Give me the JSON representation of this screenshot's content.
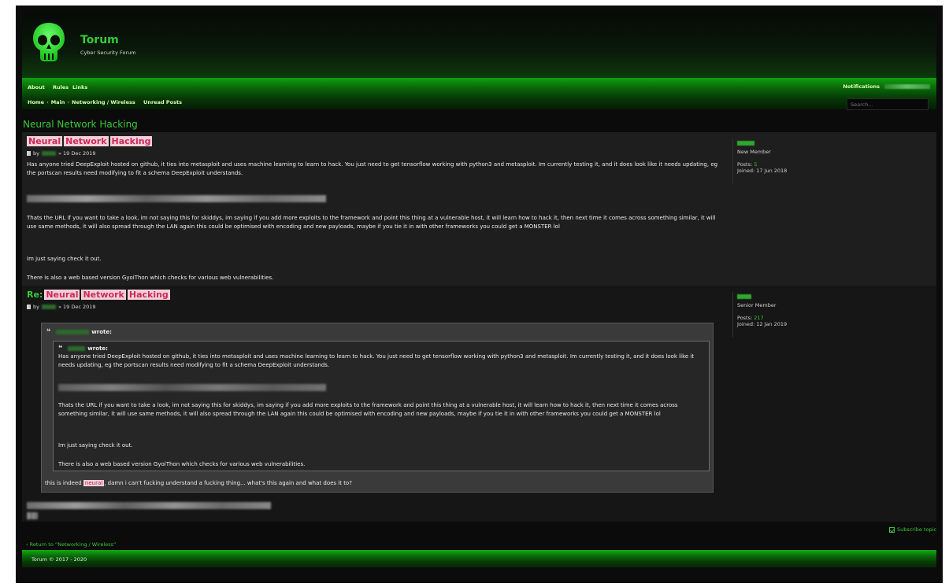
{
  "site": {
    "title": "Torum",
    "description": "Cyber Security Forum"
  },
  "nav": {
    "links": [
      "About",
      "Rules",
      "Links"
    ],
    "notifications_label": "Notifications",
    "breadcrumb": [
      "Home",
      "Main",
      "Networking / Wireless"
    ],
    "breadcrumb_sep": "‹",
    "unread_posts": "Unread Posts",
    "search_placeholder": "Search..."
  },
  "page_title": "Neural Network Hacking",
  "posts": [
    {
      "title_words": [
        "Neural",
        "Network",
        "Hacking"
      ],
      "meta_by": "by",
      "meta_date": "» 19 Dec 2019",
      "paragraphs": [
        "Has anyone tried DeepExploit hosted on github, it ties into metasploit and uses machine learning to learn to hack. You just need to get tensorflow working with python3 and metasploit. Im currently testing it, and it does look like it needs updating, eg the portscan results need modifying to fit a schema DeepExploit understands.",
        "Thats the URL if you want to take a look, im not saying this for skiddys, im saying if you add more exploits to the framework and point this thing at a vulnerable host, it will learn how to hack it, then next time it comes across something similar, it will use same methods, it will also spread through the LAN again this could be optimised with encoding and new payloads, maybe if you tie it in with other frameworks you could get a MONSTER lol",
        "Im just saying check it out.",
        "There is also a web based version GyoiThon which checks for various web vulnerabilities."
      ],
      "profile": {
        "rank": "New Member",
        "posts_label": "Posts:",
        "posts_value": "5",
        "joined": "Joined: 17 Jun 2018"
      }
    },
    {
      "title_prefix": "Re:",
      "title_words": [
        "Neural",
        "Network",
        "Hacking"
      ],
      "meta_by": "by",
      "meta_date": "» 19 Dec 2019",
      "outer_quote_wrote": "wrote:",
      "inner_quote_wrote": "wrote:",
      "quote_paragraphs": [
        "Has anyone tried DeepExploit hosted on github, it ties into metasploit and uses machine learning to learn to hack. You just need to get tensorflow working with python3 and metasploit. Im currently testing it, and it does look like it needs updating, eg the portscan results need modifying to fit a schema DeepExploit understands.",
        "Thats the URL if you want to take a look, im not saying this for skiddys, im saying if you add more exploits to the framework and point this thing at a vulnerable host, it will learn how to hack it, then next time it comes across something similar, it will use same methods, it will also spread through the LAN again this could be optimised with encoding and new payloads, maybe if you tie it in with other frameworks you could get a MONSTER lol",
        "Im just saying check it out.",
        "There is also a web based version GyoiThon which checks for various web vulnerabilities."
      ],
      "reply_before": "this is indeed ",
      "reply_highlight": "neural",
      "reply_after": ", damn i can't fucking understand a fucking thing... what's this again and what does it to?",
      "profile": {
        "rank": "Senior Member",
        "posts_label": "Posts:",
        "posts_value": "217",
        "joined": "Joined: 12 Jan 2019"
      }
    }
  ],
  "subscribe_label": "Subscribe topic",
  "return_link": "Return to “Networking / Wireless”",
  "footer": "Torum © 2017 - 2020",
  "colors": {
    "accent": "#38c838",
    "highlight_bg": "#f2cfd8",
    "highlight_fg": "#cc2a5a",
    "background": "#0b0b0b"
  }
}
